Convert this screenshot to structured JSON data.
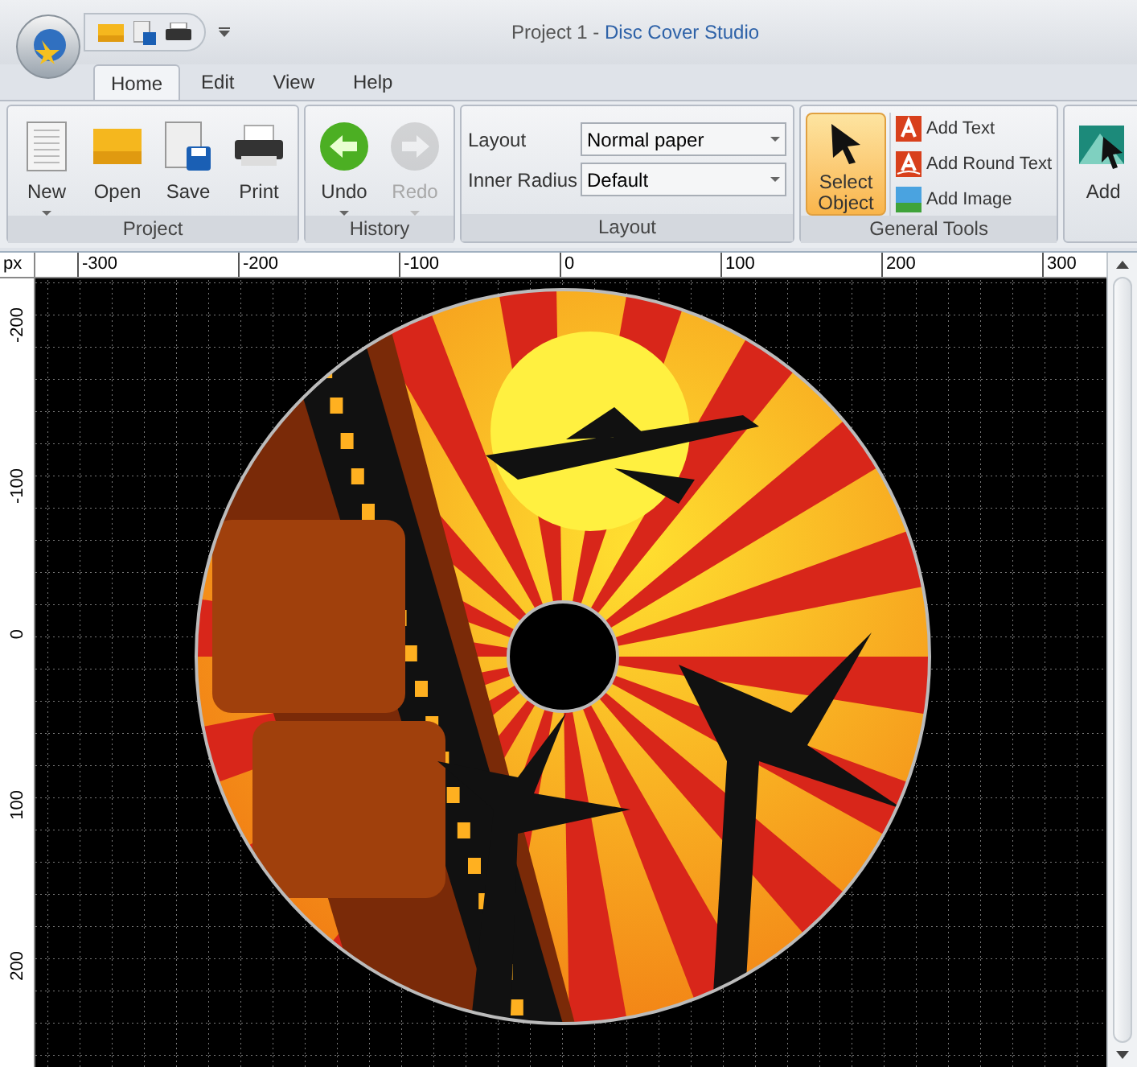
{
  "title_bar": {
    "document": "Project 1",
    "separator": "-",
    "app": "Disc Cover Studio"
  },
  "tabs": [
    {
      "label": "Home",
      "selected": true
    },
    {
      "label": "Edit",
      "selected": false
    },
    {
      "label": "View",
      "selected": false
    },
    {
      "label": "Help",
      "selected": false
    }
  ],
  "ribbon": {
    "groups": [
      {
        "kind": "buttons",
        "title": "Project",
        "buttons": [
          {
            "label": "New",
            "kind": "document",
            "dropdown": true,
            "disabled": false
          },
          {
            "label": "Open",
            "kind": "folder",
            "dropdown": false,
            "disabled": false
          },
          {
            "label": "Save",
            "kind": "save",
            "dropdown": false,
            "disabled": false
          },
          {
            "label": "Print",
            "kind": "printer",
            "dropdown": false,
            "disabled": false
          }
        ]
      },
      {
        "kind": "buttons",
        "title": "History",
        "buttons": [
          {
            "label": "Undo",
            "kind": "back",
            "dropdown": true,
            "disabled": false
          },
          {
            "label": "Redo",
            "kind": "forward",
            "dropdown": true,
            "disabled": true
          }
        ]
      },
      {
        "kind": "fields",
        "title": "Layout",
        "fields": [
          {
            "label": "Layout",
            "value": "Normal paper"
          },
          {
            "label": "Inner Radius",
            "value": "Default"
          }
        ]
      },
      {
        "kind": "tools",
        "title": "General Tools",
        "main": {
          "label": "Select Object",
          "selected": true
        },
        "items": [
          {
            "label": "Add Text",
            "kind": "text"
          },
          {
            "label": "Add Round Text",
            "kind": "round-text"
          },
          {
            "label": "Add Image",
            "kind": "image"
          }
        ]
      },
      {
        "kind": "buttons",
        "buttons": [
          {
            "label": "Add",
            "kind": "add-picture",
            "dropdown": false,
            "disabled": false
          }
        ]
      }
    ]
  },
  "ruler": {
    "unit": "px",
    "h_ticks": [
      "-300",
      "-200",
      "-100",
      "0",
      "100",
      "200",
      "300"
    ],
    "v_ticks": [
      "-200",
      "-100",
      "0",
      "100",
      "200"
    ]
  }
}
